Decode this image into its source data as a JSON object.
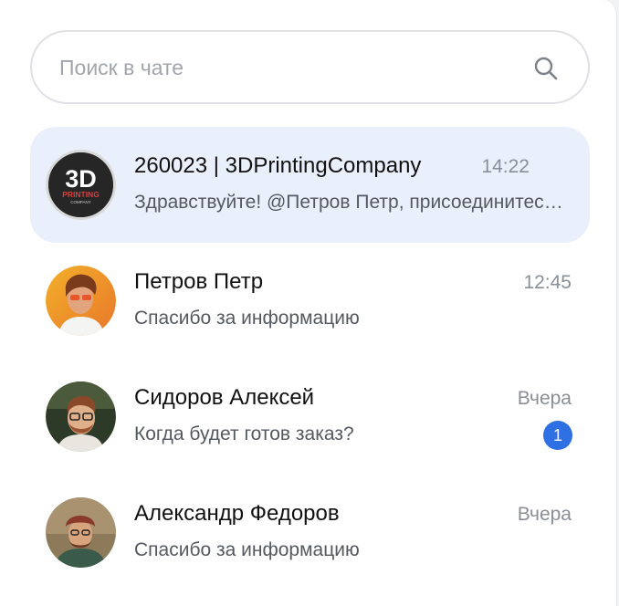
{
  "search": {
    "placeholder": "Поиск в чате",
    "value": "",
    "icon": "search-icon"
  },
  "chats": [
    {
      "name": "260023 | 3DPrintingCompany",
      "time": "14:22",
      "last_message": "Здравствуйте! @Петров Петр, присоединитесь к чату",
      "active": true,
      "avatar": {
        "type": "logo",
        "logo_text": "3D",
        "logo_sub": "PRINTING",
        "logo_sub2": "COMPANY"
      }
    },
    {
      "name": "Петров Петр",
      "time": "12:45",
      "last_message": "Спасибо за информацию",
      "active": false
    },
    {
      "name": "Сидоров Алексей",
      "time": "Вчера",
      "last_message": "Когда будет готов заказ?",
      "active": false,
      "unread": "1"
    },
    {
      "name": "Александр Федоров",
      "time": "Вчера",
      "last_message": "Спасибо за информацию",
      "active": false
    }
  ],
  "colors": {
    "accent": "#2f6fe4",
    "active_bg": "#eaeffc"
  }
}
